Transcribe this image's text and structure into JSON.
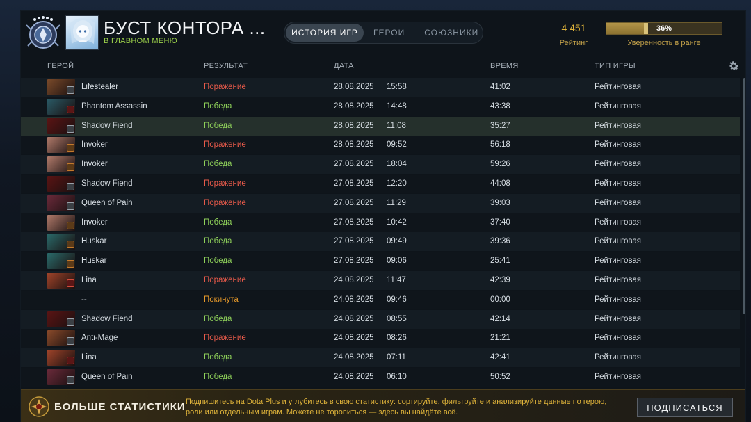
{
  "header": {
    "profile_name": "БУСТ КОНТОРА ...",
    "back_link": "В ГЛАВНОМ МЕНЮ",
    "tabs": [
      {
        "label": "ИСТОРИЯ ИГР",
        "active": true
      },
      {
        "label": "ГЕРОИ",
        "active": false
      },
      {
        "label": "СОЮЗНИКИ",
        "active": false
      }
    ],
    "rating_value": "4 451",
    "rating_label": "Рейтинг",
    "confidence_percent": 36,
    "confidence_text": "36%",
    "confidence_label": "Уверенность в ранге"
  },
  "table": {
    "columns": {
      "hero": "ГЕРОЙ",
      "result": "РЕЗУЛЬТАТ",
      "date": "ДАТА",
      "time": "ВРЕМЯ",
      "mode": "ТИП ИГРЫ"
    },
    "rows": [
      {
        "hero": "Lifestealer",
        "result": "Поражение",
        "status": "loss",
        "date": "28.08.2025",
        "clock": "15:58",
        "duration": "41:02",
        "mode": "Рейтинговая",
        "portrait": "#7a4a2a",
        "badge": "gray"
      },
      {
        "hero": "Phantom Assassin",
        "result": "Победа",
        "status": "win",
        "date": "28.08.2025",
        "clock": "14:48",
        "duration": "43:38",
        "mode": "Рейтинговая",
        "portrait": "#2a5a66",
        "badge": "red"
      },
      {
        "hero": "Shadow Fiend",
        "result": "Победа",
        "status": "win",
        "date": "28.08.2025",
        "clock": "11:08",
        "duration": "35:27",
        "mode": "Рейтинговая",
        "portrait": "#5a1414",
        "badge": "gray",
        "highlight": true
      },
      {
        "hero": "Invoker",
        "result": "Поражение",
        "status": "loss",
        "date": "28.08.2025",
        "clock": "09:52",
        "duration": "56:18",
        "mode": "Рейтинговая",
        "portrait": "#b07a6a",
        "badge": "orange"
      },
      {
        "hero": "Invoker",
        "result": "Победа",
        "status": "win",
        "date": "27.08.2025",
        "clock": "18:04",
        "duration": "59:26",
        "mode": "Рейтинговая",
        "portrait": "#b07a6a",
        "badge": "orange"
      },
      {
        "hero": "Shadow Fiend",
        "result": "Поражение",
        "status": "loss",
        "date": "27.08.2025",
        "clock": "12:20",
        "duration": "44:08",
        "mode": "Рейтинговая",
        "portrait": "#5a1414",
        "badge": "gray"
      },
      {
        "hero": "Queen of Pain",
        "result": "Поражение",
        "status": "loss",
        "date": "27.08.2025",
        "clock": "11:29",
        "duration": "39:03",
        "mode": "Рейтинговая",
        "portrait": "#6a2a3a",
        "badge": "gray"
      },
      {
        "hero": "Invoker",
        "result": "Победа",
        "status": "win",
        "date": "27.08.2025",
        "clock": "10:42",
        "duration": "37:40",
        "mode": "Рейтинговая",
        "portrait": "#b07a6a",
        "badge": "orange"
      },
      {
        "hero": "Huskar",
        "result": "Победа",
        "status": "win",
        "date": "27.08.2025",
        "clock": "09:49",
        "duration": "39:36",
        "mode": "Рейтинговая",
        "portrait": "#2a6a6a",
        "badge": "orange"
      },
      {
        "hero": "Huskar",
        "result": "Победа",
        "status": "win",
        "date": "27.08.2025",
        "clock": "09:06",
        "duration": "25:41",
        "mode": "Рейтинговая",
        "portrait": "#2a6a6a",
        "badge": "orange"
      },
      {
        "hero": "Lina",
        "result": "Поражение",
        "status": "loss",
        "date": "24.08.2025",
        "clock": "11:47",
        "duration": "42:39",
        "mode": "Рейтинговая",
        "portrait": "#a0442a",
        "badge": "red"
      },
      {
        "hero": "--",
        "result": "Покинута",
        "status": "abandon",
        "date": "24.08.2025",
        "clock": "09:46",
        "duration": "00:00",
        "mode": "Рейтинговая",
        "portrait": "",
        "badge": ""
      },
      {
        "hero": "Shadow Fiend",
        "result": "Победа",
        "status": "win",
        "date": "24.08.2025",
        "clock": "08:55",
        "duration": "42:14",
        "mode": "Рейтинговая",
        "portrait": "#5a1414",
        "badge": "gray"
      },
      {
        "hero": "Anti-Mage",
        "result": "Поражение",
        "status": "loss",
        "date": "24.08.2025",
        "clock": "08:26",
        "duration": "21:21",
        "mode": "Рейтинговая",
        "portrait": "#8a4a2a",
        "badge": "gray"
      },
      {
        "hero": "Lina",
        "result": "Победа",
        "status": "win",
        "date": "24.08.2025",
        "clock": "07:11",
        "duration": "42:41",
        "mode": "Рейтинговая",
        "portrait": "#a0442a",
        "badge": "red"
      },
      {
        "hero": "Queen of Pain",
        "result": "Победа",
        "status": "win",
        "date": "24.08.2025",
        "clock": "06:10",
        "duration": "50:52",
        "mode": "Рейтинговая",
        "portrait": "#6a2a3a",
        "badge": "gray"
      }
    ]
  },
  "footer": {
    "title": "БОЛЬШЕ СТАТИСТИКИ",
    "text": "Подпишитесь на Dota Plus и углубитесь в свою статистику: сортируйте, фильтруйте и анализируйте данные по герою, роли или отдельным играм. Можете не торопиться — здесь вы найдёте всё.",
    "button": "ПОДПИСАТЬСЯ"
  },
  "colors": {
    "win": "#8fd15a",
    "loss": "#e85a4a",
    "abandon": "#e89a2a",
    "accent_gold": "#e0b43a",
    "highlight_row": "#25302c"
  },
  "icons": {
    "rank": "rank-medal-icon",
    "settings": "gear-icon",
    "footer": "dota-plus-icon"
  }
}
